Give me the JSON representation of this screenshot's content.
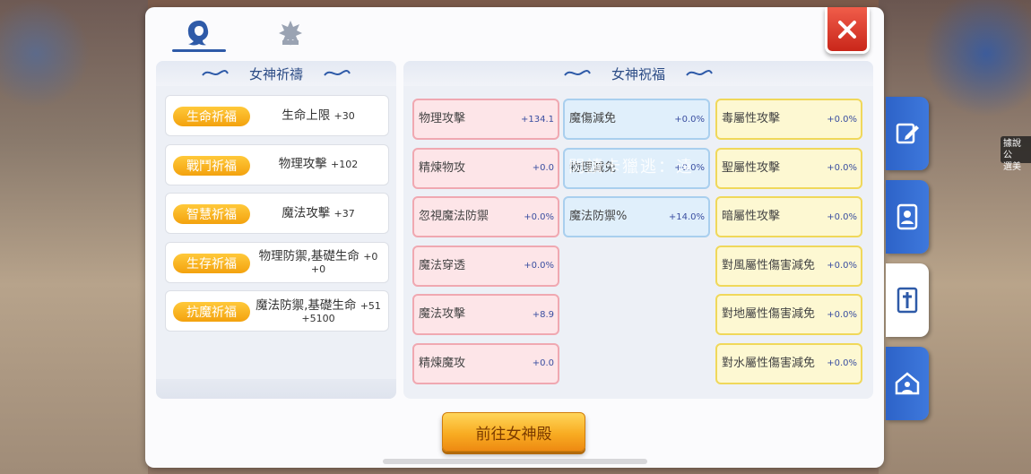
{
  "tabs": [
    {
      "icon": "goddess-hair-icon",
      "active": true
    },
    {
      "icon": "star-emblem-icon",
      "active": false
    }
  ],
  "left": {
    "title": "女神祈禱",
    "prayers": [
      {
        "label": "生命祈福",
        "stat": "生命上限",
        "value": "+30",
        "extra": ""
      },
      {
        "label": "戰鬥祈福",
        "stat": "物理攻擊",
        "value": "+102",
        "extra": ""
      },
      {
        "label": "智慧祈福",
        "stat": "魔法攻擊",
        "value": "+37",
        "extra": ""
      },
      {
        "label": "生存祈福",
        "stat": "物理防禦,基礎生命",
        "value": "+0",
        "extra": "+0"
      },
      {
        "label": "抗魔祈福",
        "stat": "魔法防禦,基礎生命",
        "value": "+51",
        "extra": "+5100"
      }
    ]
  },
  "right": {
    "title": "女神祝福",
    "col1": [
      {
        "name": "物理攻擊",
        "value": "+134.1"
      },
      {
        "name": "精煉物攻",
        "value": "+0.0"
      },
      {
        "name": "忽視魔法防禦",
        "value": "+0.0%"
      },
      {
        "name": "魔法穿透",
        "value": "+0.0%"
      },
      {
        "name": "魔法攻擊",
        "value": "+8.9"
      },
      {
        "name": "精煉魔攻",
        "value": "+0.0"
      }
    ],
    "col2": [
      {
        "name": "魔傷減免",
        "value": "+0.0%"
      },
      {
        "name": "物理減免",
        "value": "+0.0%"
      },
      {
        "name": "魔法防禦%",
        "value": "+14.0%"
      }
    ],
    "col3": [
      {
        "name": "毒屬性攻擊",
        "value": "+0.0%"
      },
      {
        "name": "聖屬性攻擊",
        "value": "+0.0%"
      },
      {
        "name": "暗屬性攻擊",
        "value": "+0.0%"
      },
      {
        "name": "對風屬性傷害減免",
        "value": "+0.0%"
      },
      {
        "name": "對地屬性傷害減免",
        "value": "+0.0%"
      },
      {
        "name": "對水屬性傷害減免",
        "value": "+0.0%"
      }
    ]
  },
  "watermark": "閃讀卡獵逃：遠",
  "go_button": "前往女神殿",
  "side_note": "據說公\n選美",
  "side_tabs": [
    {
      "icon": "edit-note-icon",
      "active": false
    },
    {
      "icon": "contact-book-icon",
      "active": false
    },
    {
      "icon": "goddess-cross-icon",
      "active": true
    },
    {
      "icon": "guild-house-icon",
      "active": false
    }
  ],
  "colors": {
    "accent": "#2e5aa8",
    "pill": "#f5a916",
    "close": "#d8382a"
  }
}
